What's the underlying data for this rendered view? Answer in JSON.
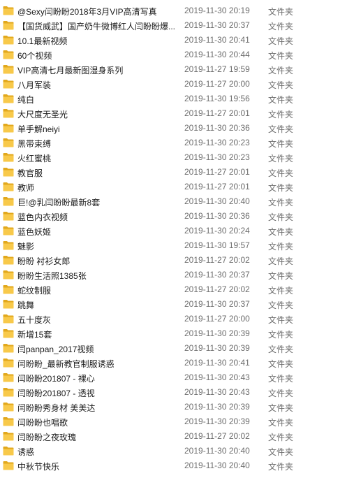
{
  "icons": {
    "folder": "folder-icon",
    "folder_color": "#f8c94a",
    "folder_dark": "#e2a81c"
  },
  "files": [
    {
      "name": "@Sexy闫盼盼2018年3月VIP高清写真",
      "date": "2019-11-30 20:19",
      "type": "文件夹"
    },
    {
      "name": "【国货威武】国产奶牛微博红人闫盼盼爆...",
      "date": "2019-11-30 20:37",
      "type": "文件夹"
    },
    {
      "name": "10.1最新视频",
      "date": "2019-11-30 20:41",
      "type": "文件夹"
    },
    {
      "name": "60个视频",
      "date": "2019-11-30 20:44",
      "type": "文件夹"
    },
    {
      "name": "VIP高清七月最新图湿身系列",
      "date": "2019-11-27 19:59",
      "type": "文件夹"
    },
    {
      "name": "八月军装",
      "date": "2019-11-27 20:00",
      "type": "文件夹"
    },
    {
      "name": "纯白",
      "date": "2019-11-30 19:56",
      "type": "文件夹"
    },
    {
      "name": "大尺度无圣光",
      "date": "2019-11-27 20:01",
      "type": "文件夹"
    },
    {
      "name": "单手解neiyi",
      "date": "2019-11-30 20:36",
      "type": "文件夹"
    },
    {
      "name": "黑带束缚",
      "date": "2019-11-30 20:23",
      "type": "文件夹"
    },
    {
      "name": "火红蜜桃",
      "date": "2019-11-30 20:23",
      "type": "文件夹"
    },
    {
      "name": "教官服",
      "date": "2019-11-27 20:01",
      "type": "文件夹"
    },
    {
      "name": "教师",
      "date": "2019-11-27 20:01",
      "type": "文件夹"
    },
    {
      "name": "巨!@乳闫盼盼最新8套",
      "date": "2019-11-30 20:40",
      "type": "文件夹"
    },
    {
      "name": "蓝色内衣视频",
      "date": "2019-11-30 20:36",
      "type": "文件夹"
    },
    {
      "name": "蓝色妖姬",
      "date": "2019-11-30 20:24",
      "type": "文件夹"
    },
    {
      "name": "魅影",
      "date": "2019-11-30 19:57",
      "type": "文件夹"
    },
    {
      "name": "盼盼  衬衫女郎",
      "date": "2019-11-27 20:02",
      "type": "文件夹"
    },
    {
      "name": "盼盼生活照1385张",
      "date": "2019-11-30 20:37",
      "type": "文件夹"
    },
    {
      "name": "蛇纹制服",
      "date": "2019-11-27 20:02",
      "type": "文件夹"
    },
    {
      "name": "跳舞",
      "date": "2019-11-30 20:37",
      "type": "文件夹"
    },
    {
      "name": "五十度灰",
      "date": "2019-11-27 20:00",
      "type": "文件夹"
    },
    {
      "name": "新增15套",
      "date": "2019-11-30 20:39",
      "type": "文件夹"
    },
    {
      "name": "闫panpan_2017视频",
      "date": "2019-11-30 20:39",
      "type": "文件夹"
    },
    {
      "name": "闫盼盼_最新教官制服诱惑",
      "date": "2019-11-30 20:41",
      "type": "文件夹"
    },
    {
      "name": "闫盼盼201807 - 裸心",
      "date": "2019-11-30 20:43",
      "type": "文件夹"
    },
    {
      "name": "闫盼盼201807 - 透视",
      "date": "2019-11-30 20:43",
      "type": "文件夹"
    },
    {
      "name": "闫盼盼秀身材 美美达",
      "date": "2019-11-30 20:39",
      "type": "文件夹"
    },
    {
      "name": "闫盼盼也唱歌",
      "date": "2019-11-30 20:39",
      "type": "文件夹"
    },
    {
      "name": "闫盼盼之夜玫瑰",
      "date": "2019-11-27 20:02",
      "type": "文件夹"
    },
    {
      "name": "诱惑",
      "date": "2019-11-30 20:40",
      "type": "文件夹"
    },
    {
      "name": "中秋节快乐",
      "date": "2019-11-30 20:40",
      "type": "文件夹"
    }
  ]
}
